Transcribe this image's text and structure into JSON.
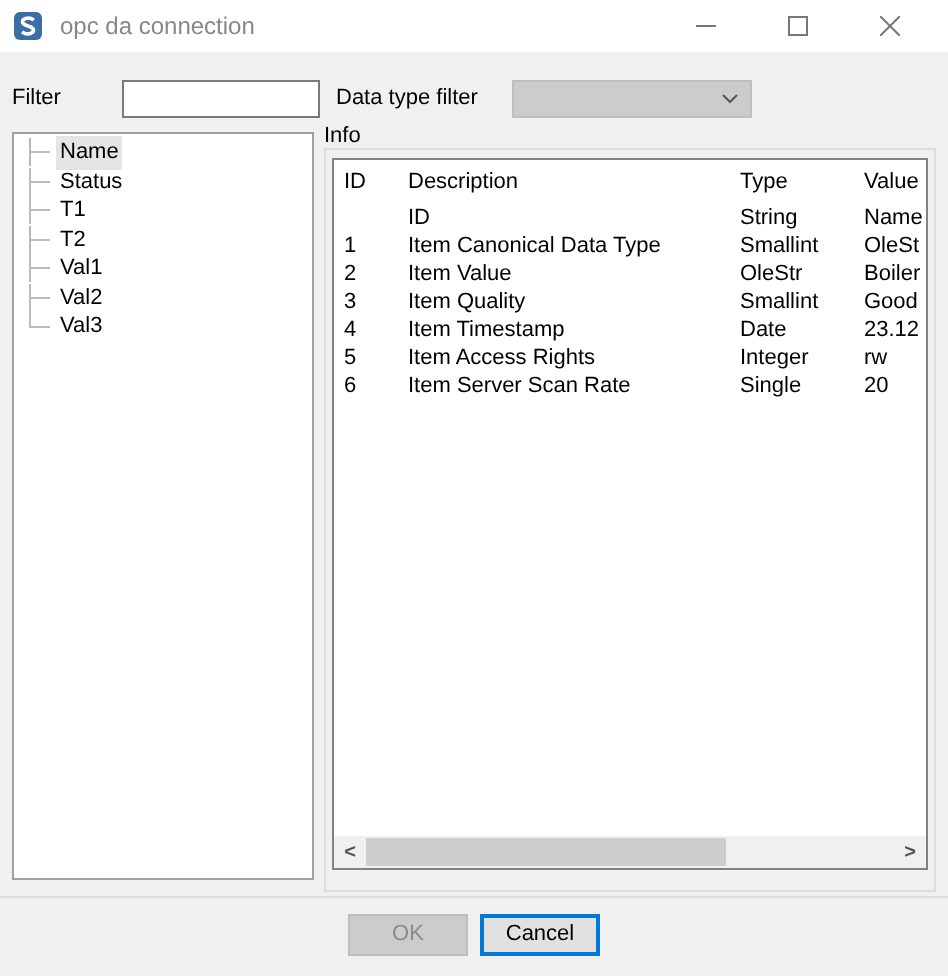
{
  "window": {
    "title": "opc da connection"
  },
  "filter": {
    "label": "Filter"
  },
  "data_type_filter": {
    "label": "Data type filter",
    "disabled": true
  },
  "tree": {
    "items": [
      {
        "label": "Name",
        "selected": true
      },
      {
        "label": "Status",
        "selected": false
      },
      {
        "label": "T1",
        "selected": false
      },
      {
        "label": "T2",
        "selected": false
      },
      {
        "label": "Val1",
        "selected": false
      },
      {
        "label": "Val2",
        "selected": false
      },
      {
        "label": "Val3",
        "selected": false
      }
    ]
  },
  "info": {
    "title": "Info",
    "columns": [
      "ID",
      "Description",
      "Type",
      "Value"
    ],
    "rows": [
      [
        "",
        "ID",
        "String",
        "Name"
      ],
      [
        "1",
        "Item Canonical Data Type",
        "Smallint",
        "OleSt"
      ],
      [
        "2",
        "Item Value",
        "OleStr",
        "Boiler"
      ],
      [
        "3",
        "Item Quality",
        "Smallint",
        "Good"
      ],
      [
        "4",
        "Item Timestamp",
        "Date",
        "23.12"
      ],
      [
        "5",
        "Item Access Rights",
        "Integer",
        "rw"
      ],
      [
        "6",
        "Item Server Scan Rate",
        "Single",
        "20"
      ]
    ],
    "scroll_left": "<",
    "scroll_right": ">"
  },
  "buttons": [
    {
      "label": "OK",
      "disabled": true,
      "focused": false
    },
    {
      "label": "Cancel",
      "disabled": false,
      "focused": true
    }
  ]
}
